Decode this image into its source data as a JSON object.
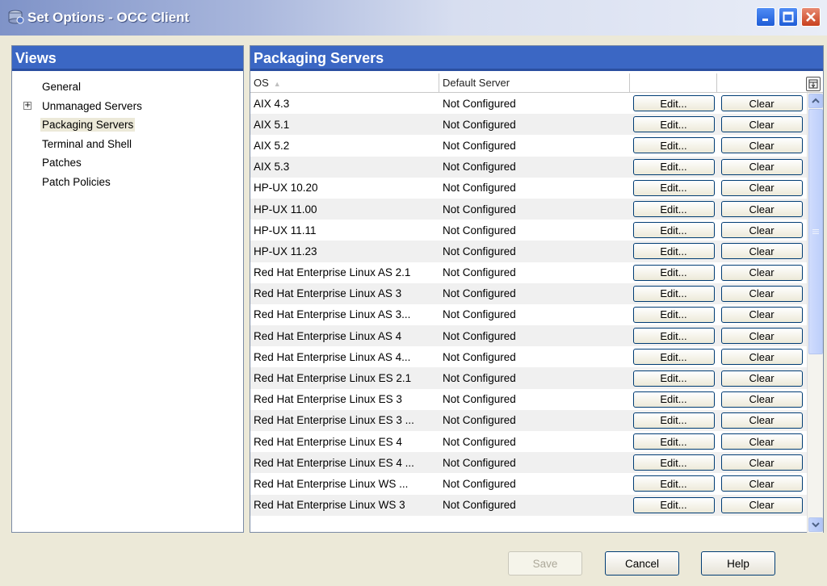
{
  "window": {
    "title": "Set Options - OCC Client"
  },
  "views": {
    "header": "Views",
    "items": [
      {
        "label": "General",
        "expandable": false,
        "selected": false
      },
      {
        "label": "Unmanaged Servers",
        "expandable": true,
        "selected": false
      },
      {
        "label": "Packaging Servers",
        "expandable": false,
        "selected": true
      },
      {
        "label": "Terminal and Shell",
        "expandable": false,
        "selected": false
      },
      {
        "label": "Patches",
        "expandable": false,
        "selected": false
      },
      {
        "label": "Patch Policies",
        "expandable": false,
        "selected": false
      }
    ]
  },
  "packaging": {
    "header": "Packaging Servers",
    "columns": {
      "os": "OS",
      "server": "Default Server",
      "edit": "",
      "clear": ""
    },
    "edit_label": "Edit...",
    "clear_label": "Clear",
    "rows": [
      {
        "os": "AIX 4.3",
        "server": "Not Configured"
      },
      {
        "os": "AIX 5.1",
        "server": "Not Configured"
      },
      {
        "os": "AIX 5.2",
        "server": "Not Configured"
      },
      {
        "os": "AIX 5.3",
        "server": "Not Configured"
      },
      {
        "os": "HP-UX 10.20",
        "server": "Not Configured"
      },
      {
        "os": "HP-UX 11.00",
        "server": "Not Configured"
      },
      {
        "os": "HP-UX 11.11",
        "server": "Not Configured"
      },
      {
        "os": "HP-UX 11.23",
        "server": "Not Configured"
      },
      {
        "os": "Red Hat Enterprise Linux AS 2.1",
        "server": "Not Configured"
      },
      {
        "os": "Red Hat Enterprise Linux AS 3",
        "server": "Not Configured"
      },
      {
        "os": "Red Hat Enterprise Linux AS 3...",
        "server": "Not Configured"
      },
      {
        "os": "Red Hat Enterprise Linux AS 4",
        "server": "Not Configured"
      },
      {
        "os": "Red Hat Enterprise Linux AS 4...",
        "server": "Not Configured"
      },
      {
        "os": "Red Hat Enterprise Linux ES 2.1",
        "server": "Not Configured"
      },
      {
        "os": "Red Hat Enterprise Linux ES 3",
        "server": "Not Configured"
      },
      {
        "os": "Red Hat Enterprise Linux ES 3 ...",
        "server": "Not Configured"
      },
      {
        "os": "Red Hat Enterprise Linux ES 4",
        "server": "Not Configured"
      },
      {
        "os": "Red Hat Enterprise Linux ES 4 ...",
        "server": "Not Configured"
      },
      {
        "os": "Red Hat Enterprise Linux WS ...",
        "server": "Not Configured"
      },
      {
        "os": "Red Hat Enterprise Linux WS 3",
        "server": "Not Configured"
      }
    ]
  },
  "footer": {
    "save": "Save",
    "cancel": "Cancel",
    "help": "Help",
    "save_enabled": false
  }
}
